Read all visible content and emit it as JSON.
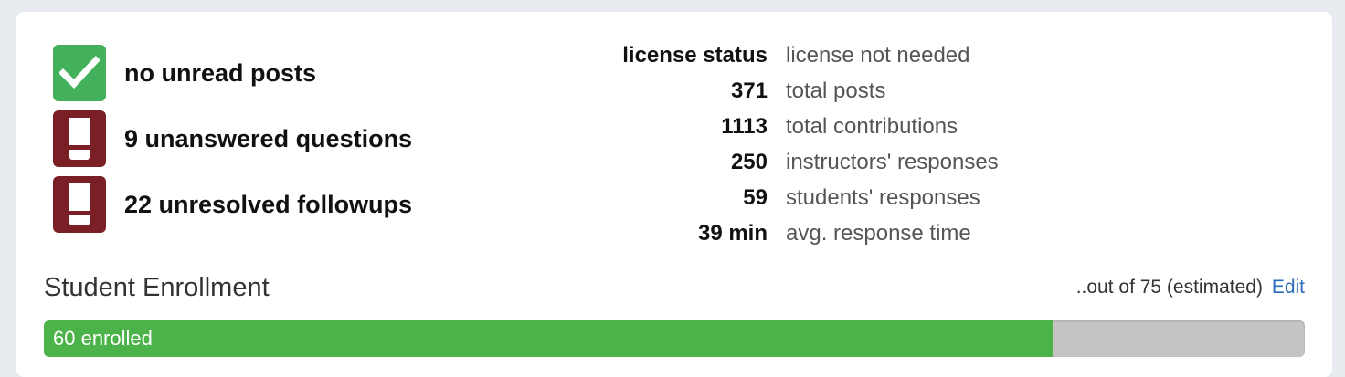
{
  "status": [
    {
      "icon": "check-icon",
      "text": "no unread posts",
      "color": "#43b05c"
    },
    {
      "icon": "exclamation-icon",
      "text": "9 unanswered questions",
      "color": "#7b1f26"
    },
    {
      "icon": "exclamation-icon",
      "text": "22 unresolved followups",
      "color": "#7b1f26"
    }
  ],
  "stats": [
    {
      "key": "license status",
      "value": "license not needed"
    },
    {
      "key": "371",
      "value": "total posts"
    },
    {
      "key": "1113",
      "value": "total contributions"
    },
    {
      "key": "250",
      "value": "instructors' responses"
    },
    {
      "key": "59",
      "value": "students' responses"
    },
    {
      "key": "39 min",
      "value": "avg. response time"
    }
  ],
  "enrollment": {
    "title": "Student Enrollment",
    "estimate_text": "..out of 75 (estimated)",
    "edit_label": "Edit",
    "enrolled_label": "60 enrolled",
    "enrolled": 60,
    "estimated_total": 75,
    "bar_color": "#4cb34a"
  }
}
